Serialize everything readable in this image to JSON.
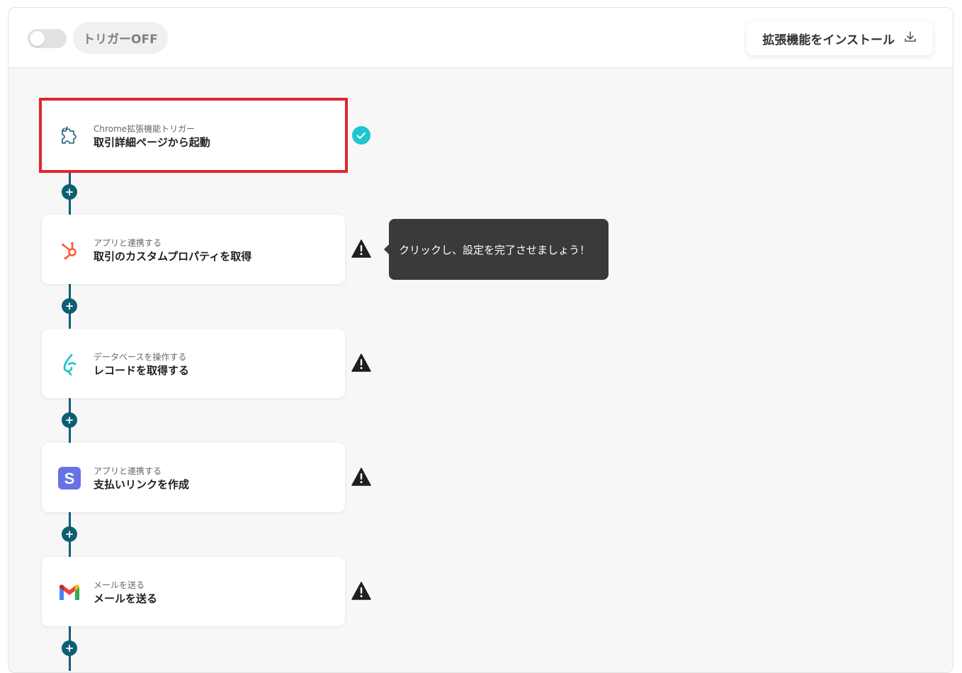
{
  "header": {
    "toggle_state": "off",
    "trigger_status": "トリガーOFF",
    "install_button": "拡張機能をインストール"
  },
  "steps": [
    {
      "category": "Chrome拡張機能トリガー",
      "title": "取引詳細ページから起動",
      "icon": "puzzle-icon",
      "status": "complete",
      "selected": true
    },
    {
      "category": "アプリと連携する",
      "title": "取引のカスタムプロパティを取得",
      "icon": "hubspot-icon",
      "status": "warning"
    },
    {
      "category": "データベースを操作する",
      "title": "レコードを取得する",
      "icon": "kintone-icon",
      "status": "warning"
    },
    {
      "category": "アプリと連携する",
      "title": "支払いリンクを作成",
      "icon": "stripe-icon",
      "status": "warning"
    },
    {
      "category": "メールを送る",
      "title": "メールを送る",
      "icon": "gmail-icon",
      "status": "warning"
    }
  ],
  "tooltip": {
    "text": "クリックし、設定を完了させましょう！"
  },
  "colors": {
    "connector": "#0b5f73",
    "selected_border": "#e0252d",
    "check": "#1fc6d1",
    "hubspot": "#ff5c35",
    "kintone": "#19c3c9",
    "stripe": "#6772e5"
  }
}
